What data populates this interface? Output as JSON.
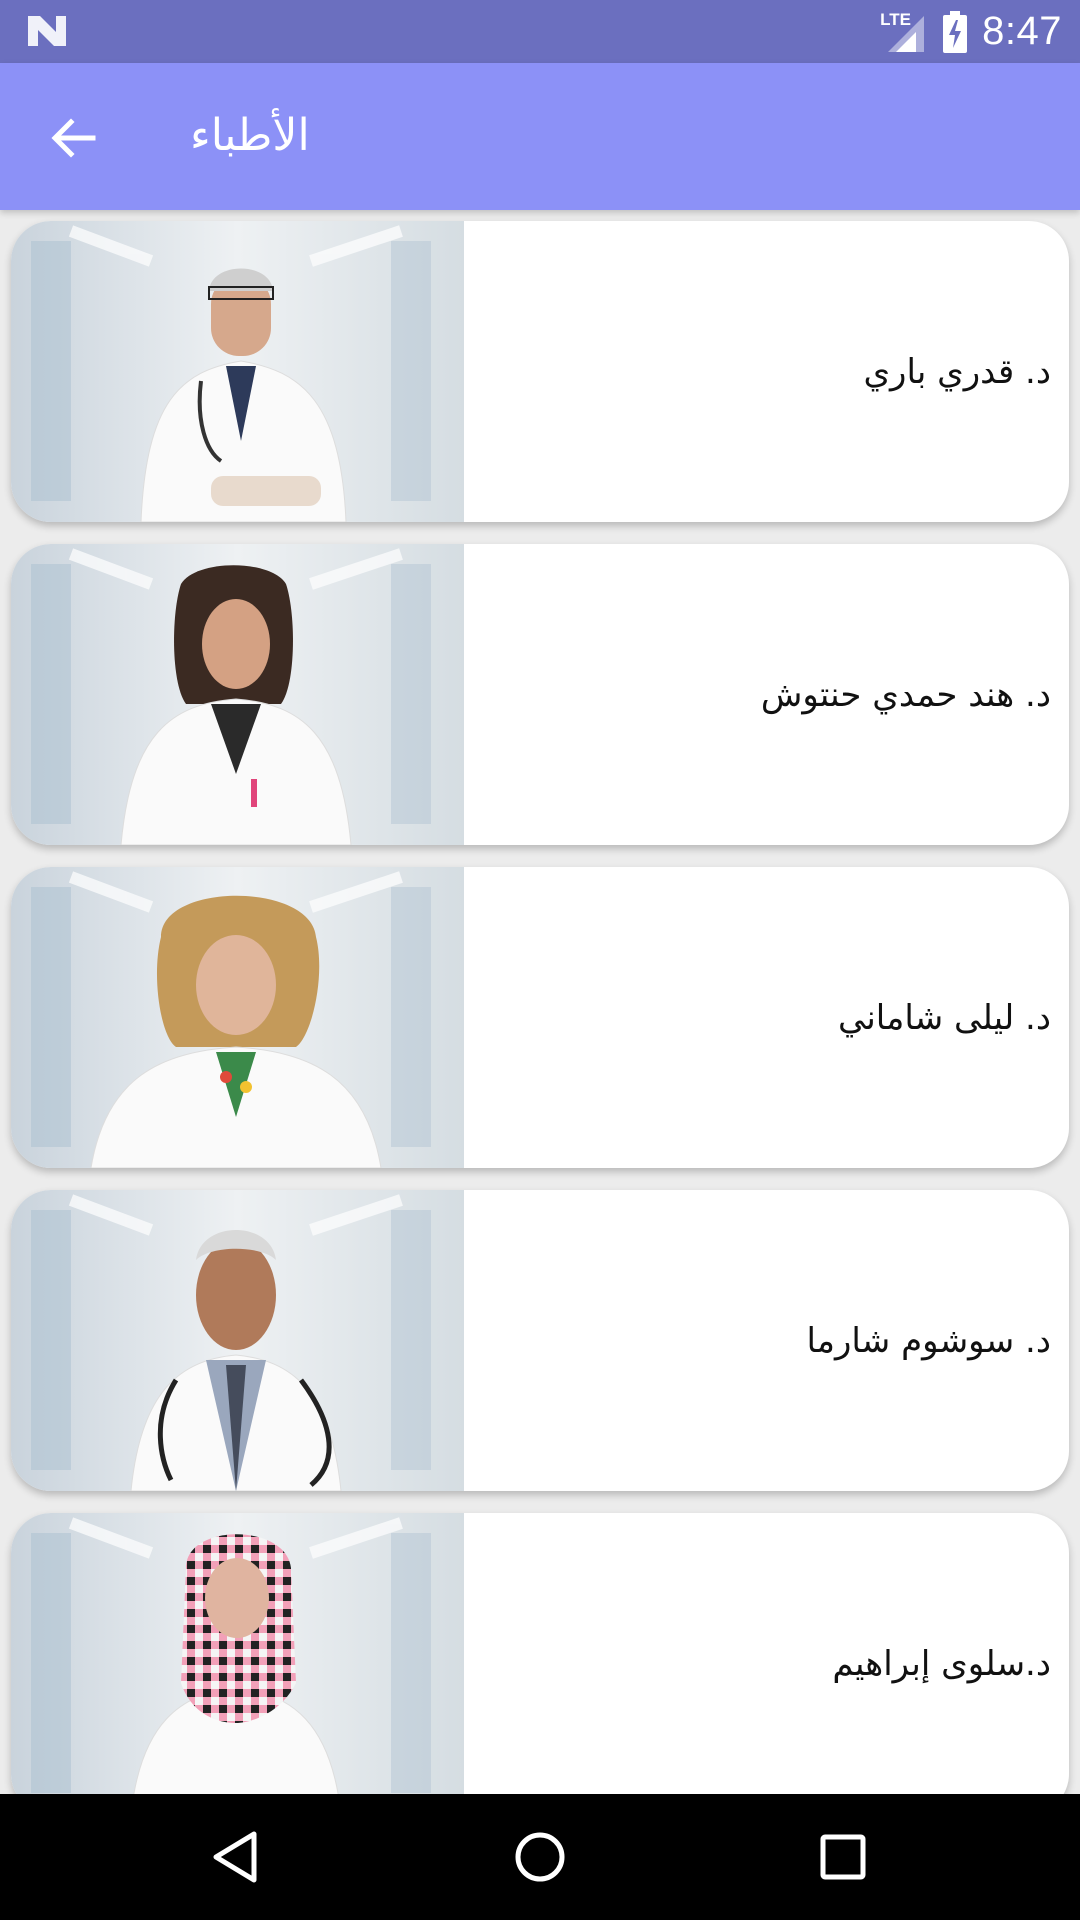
{
  "status_bar": {
    "time": "8:47",
    "network_label": "LTE",
    "icons": [
      "notification-n-icon",
      "signal-icon",
      "battery-charging-icon"
    ]
  },
  "app_bar": {
    "title": "الأطباء",
    "back_icon": "arrow-back-icon"
  },
  "doctors": [
    {
      "name": "د. قدري باري",
      "attire": "white coat, tie, stethoscope, glasses"
    },
    {
      "name": "د. هند حمدي حنتوش",
      "attire": "white coat"
    },
    {
      "name": "د. ليلى شاماني",
      "attire": "white coat, floral top"
    },
    {
      "name": "د. سوشوم شارما",
      "attire": "white coat, tie, stethoscope"
    },
    {
      "name": "د.سلوى إبراهيم",
      "attire": "white coat, patterned headscarf"
    }
  ],
  "nav_bar": {
    "icons": [
      "back-triangle-icon",
      "home-circle-icon",
      "recents-square-icon"
    ]
  },
  "colors": {
    "status_bar": "#6b6fbf",
    "app_bar": "#8c91f7",
    "background": "#ececec",
    "card": "#ffffff"
  }
}
